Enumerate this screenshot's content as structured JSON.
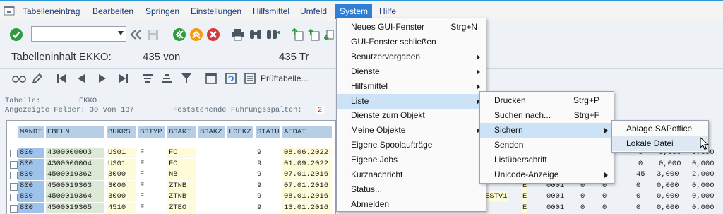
{
  "menubar": {
    "items": [
      {
        "label": "Tabelleneintrag"
      },
      {
        "label": "Bearbeiten"
      },
      {
        "label": "Springen"
      },
      {
        "label": "Einstellungen"
      },
      {
        "label": "Hilfsmittel"
      },
      {
        "label": "Umfeld"
      },
      {
        "label": "System"
      },
      {
        "label": "Hilfe"
      }
    ]
  },
  "toolbar": {
    "command_field_value": "",
    "icons": [
      "check-icon",
      "back-double-icon",
      "save-icon",
      "back-icon",
      "exit-icon",
      "cancel-icon",
      "print-icon",
      "find-icon",
      "find-next-icon",
      "first-page-icon",
      "prev-page-icon",
      "next-page-icon"
    ]
  },
  "header": {
    "title_left": "Tabelleninhalt EKKO:",
    "title_mid": "435 von",
    "title_right": "435 Tr"
  },
  "apptoolbar": {
    "pruef_label": "Prüftabelle..."
  },
  "info": {
    "table_label": "Tabelle:",
    "table_value": "EKKO",
    "fields_label": "Angezeigte Felder: 30 von 137",
    "fixed_label": "Feststehende Führungsspalten:",
    "fixed_value": "2"
  },
  "table": {
    "columns": [
      "MANDT",
      "EBELN",
      "BUKRS",
      "BSTYP",
      "BSART",
      "BSAKZ",
      "LOEKZ",
      "STATU",
      "AEDAT"
    ],
    "rows": [
      [
        "800",
        "4300000003",
        "US01",
        "F",
        "FO",
        "",
        "",
        "9",
        "08.06.2022"
      ],
      [
        "800",
        "4300000004",
        "US01",
        "F",
        "FO",
        "",
        "",
        "9",
        "01.09.2022"
      ],
      [
        "800",
        "4500019362",
        "3000",
        "F",
        "NB",
        "",
        "",
        "9",
        "07.01.2016"
      ],
      [
        "800",
        "4500019363",
        "3000",
        "F",
        "ZTNB",
        "",
        "",
        "9",
        "07.01.2016"
      ],
      [
        "800",
        "4500019364",
        "3000",
        "F",
        "ZTNB",
        "",
        "",
        "9",
        "08.01.2016"
      ],
      [
        "800",
        "4500019365",
        "4510",
        "F",
        "ZTEO",
        "",
        "",
        "9",
        "13.01.2016"
      ]
    ]
  },
  "background_right": {
    "rows": [
      [
        "",
        "",
        "",
        "",
        "",
        "",
        "45",
        "3,000",
        "2,000"
      ],
      [
        "ESTV1",
        "E",
        "0001",
        "0",
        "0",
        "",
        "0",
        "0,000",
        "0,000"
      ],
      [
        "ESTV1",
        "E",
        "0001",
        "0",
        "0",
        "",
        "0",
        "0,000",
        "0,000"
      ],
      [
        "",
        "E",
        "0001",
        "0",
        "0",
        "",
        "0",
        "0,000",
        "0,000"
      ]
    ],
    "top_rows": [
      [
        "0",
        "0,000",
        "0,000"
      ],
      [
        "0",
        "0,000",
        "0,000"
      ]
    ]
  },
  "system_menu": {
    "items": [
      {
        "label": "Neues GUI-Fenster",
        "shortcut": "Strg+N",
        "submenu": false
      },
      {
        "label": "GUI-Fenster schließen",
        "shortcut": "",
        "submenu": false
      },
      {
        "label": "Benutzervorgaben",
        "shortcut": "",
        "submenu": true
      },
      {
        "label": "Dienste",
        "shortcut": "",
        "submenu": true
      },
      {
        "label": "Hilfsmittel",
        "shortcut": "",
        "submenu": true
      },
      {
        "label": "Liste",
        "shortcut": "",
        "submenu": true
      },
      {
        "label": "Dienste zum Objekt",
        "shortcut": "",
        "submenu": false
      },
      {
        "label": "Meine Objekte",
        "shortcut": "",
        "submenu": true
      },
      {
        "label": "Eigene Spoolaufträge",
        "shortcut": "",
        "submenu": false
      },
      {
        "label": "Eigene Jobs",
        "shortcut": "",
        "submenu": false
      },
      {
        "label": "Kurznachricht",
        "shortcut": "",
        "submenu": false
      },
      {
        "label": "Status...",
        "shortcut": "",
        "submenu": false
      },
      {
        "label": "Abmelden",
        "shortcut": "",
        "submenu": false
      }
    ]
  },
  "liste_menu": {
    "items": [
      {
        "label": "Drucken",
        "shortcut": "Strg+P",
        "submenu": false
      },
      {
        "label": "Suchen nach...",
        "shortcut": "Strg+F",
        "submenu": false
      },
      {
        "label": "Sichern",
        "shortcut": "",
        "submenu": true
      },
      {
        "label": "Senden",
        "shortcut": "",
        "submenu": false
      },
      {
        "label": "Listüberschrift",
        "shortcut": "",
        "submenu": false
      },
      {
        "label": "Unicode-Anzeige",
        "shortcut": "",
        "submenu": true
      }
    ]
  },
  "sichern_menu": {
    "items": [
      {
        "label": "Ablage SAPoffice"
      },
      {
        "label": "Lokale Datei"
      }
    ]
  },
  "colors": {
    "accent": "#2f7fd6",
    "green": "#2e9b3c",
    "orange": "#f39c12",
    "red": "#d9383a"
  }
}
